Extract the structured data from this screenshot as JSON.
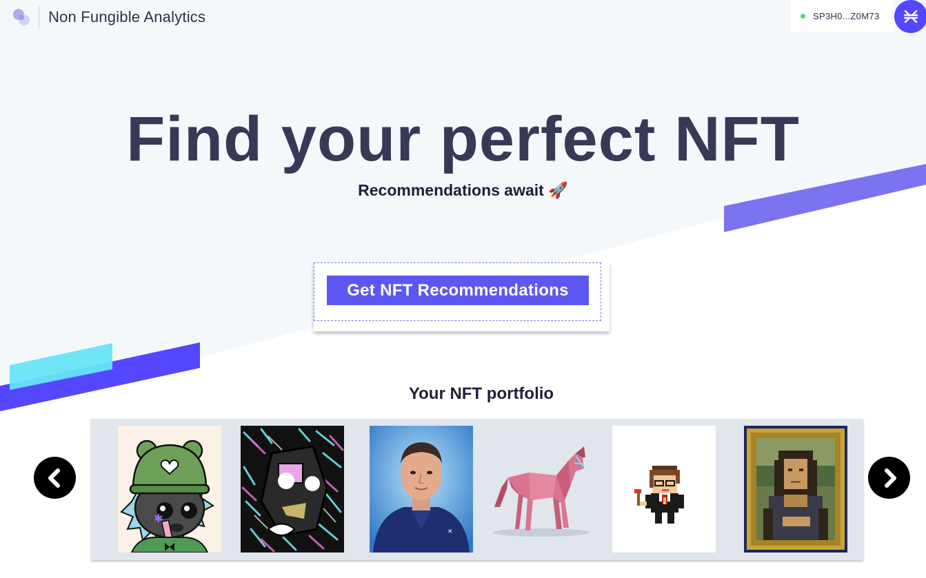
{
  "app": {
    "brand": "Non Fungible Analytics",
    "logo_icon": "overlapping-circles-logo-icon"
  },
  "wallet": {
    "status_color": "#4cd97b",
    "address": "SP3H0...Z0M73",
    "icon": "stacks-icon"
  },
  "hero": {
    "title": "Find your perfect NFT",
    "subtitle": "Recommendations await 🚀",
    "cta_label": "Get NFT Recommendations"
  },
  "portfolio": {
    "title": "Your NFT portfolio",
    "prev_icon": "chevron-left-icon",
    "next_icon": "chevron-right-icon",
    "items": [
      {
        "name": "nft-bear-hat-character"
      },
      {
        "name": "nft-abstract-glitch-art"
      },
      {
        "name": "nft-portrait-man-suit"
      },
      {
        "name": "nft-low-poly-pink-horse"
      },
      {
        "name": "nft-pixel-wizard-character"
      },
      {
        "name": "nft-pixel-mona-lisa"
      }
    ]
  },
  "colors": {
    "accent": "#5c57f2",
    "hero_bg": "#f5f8fb",
    "stripe_purple": "#7b73f0",
    "stripe_blue": "#5546ff",
    "stripe_cyan": "#67e4f6",
    "title_text": "#363a56"
  }
}
